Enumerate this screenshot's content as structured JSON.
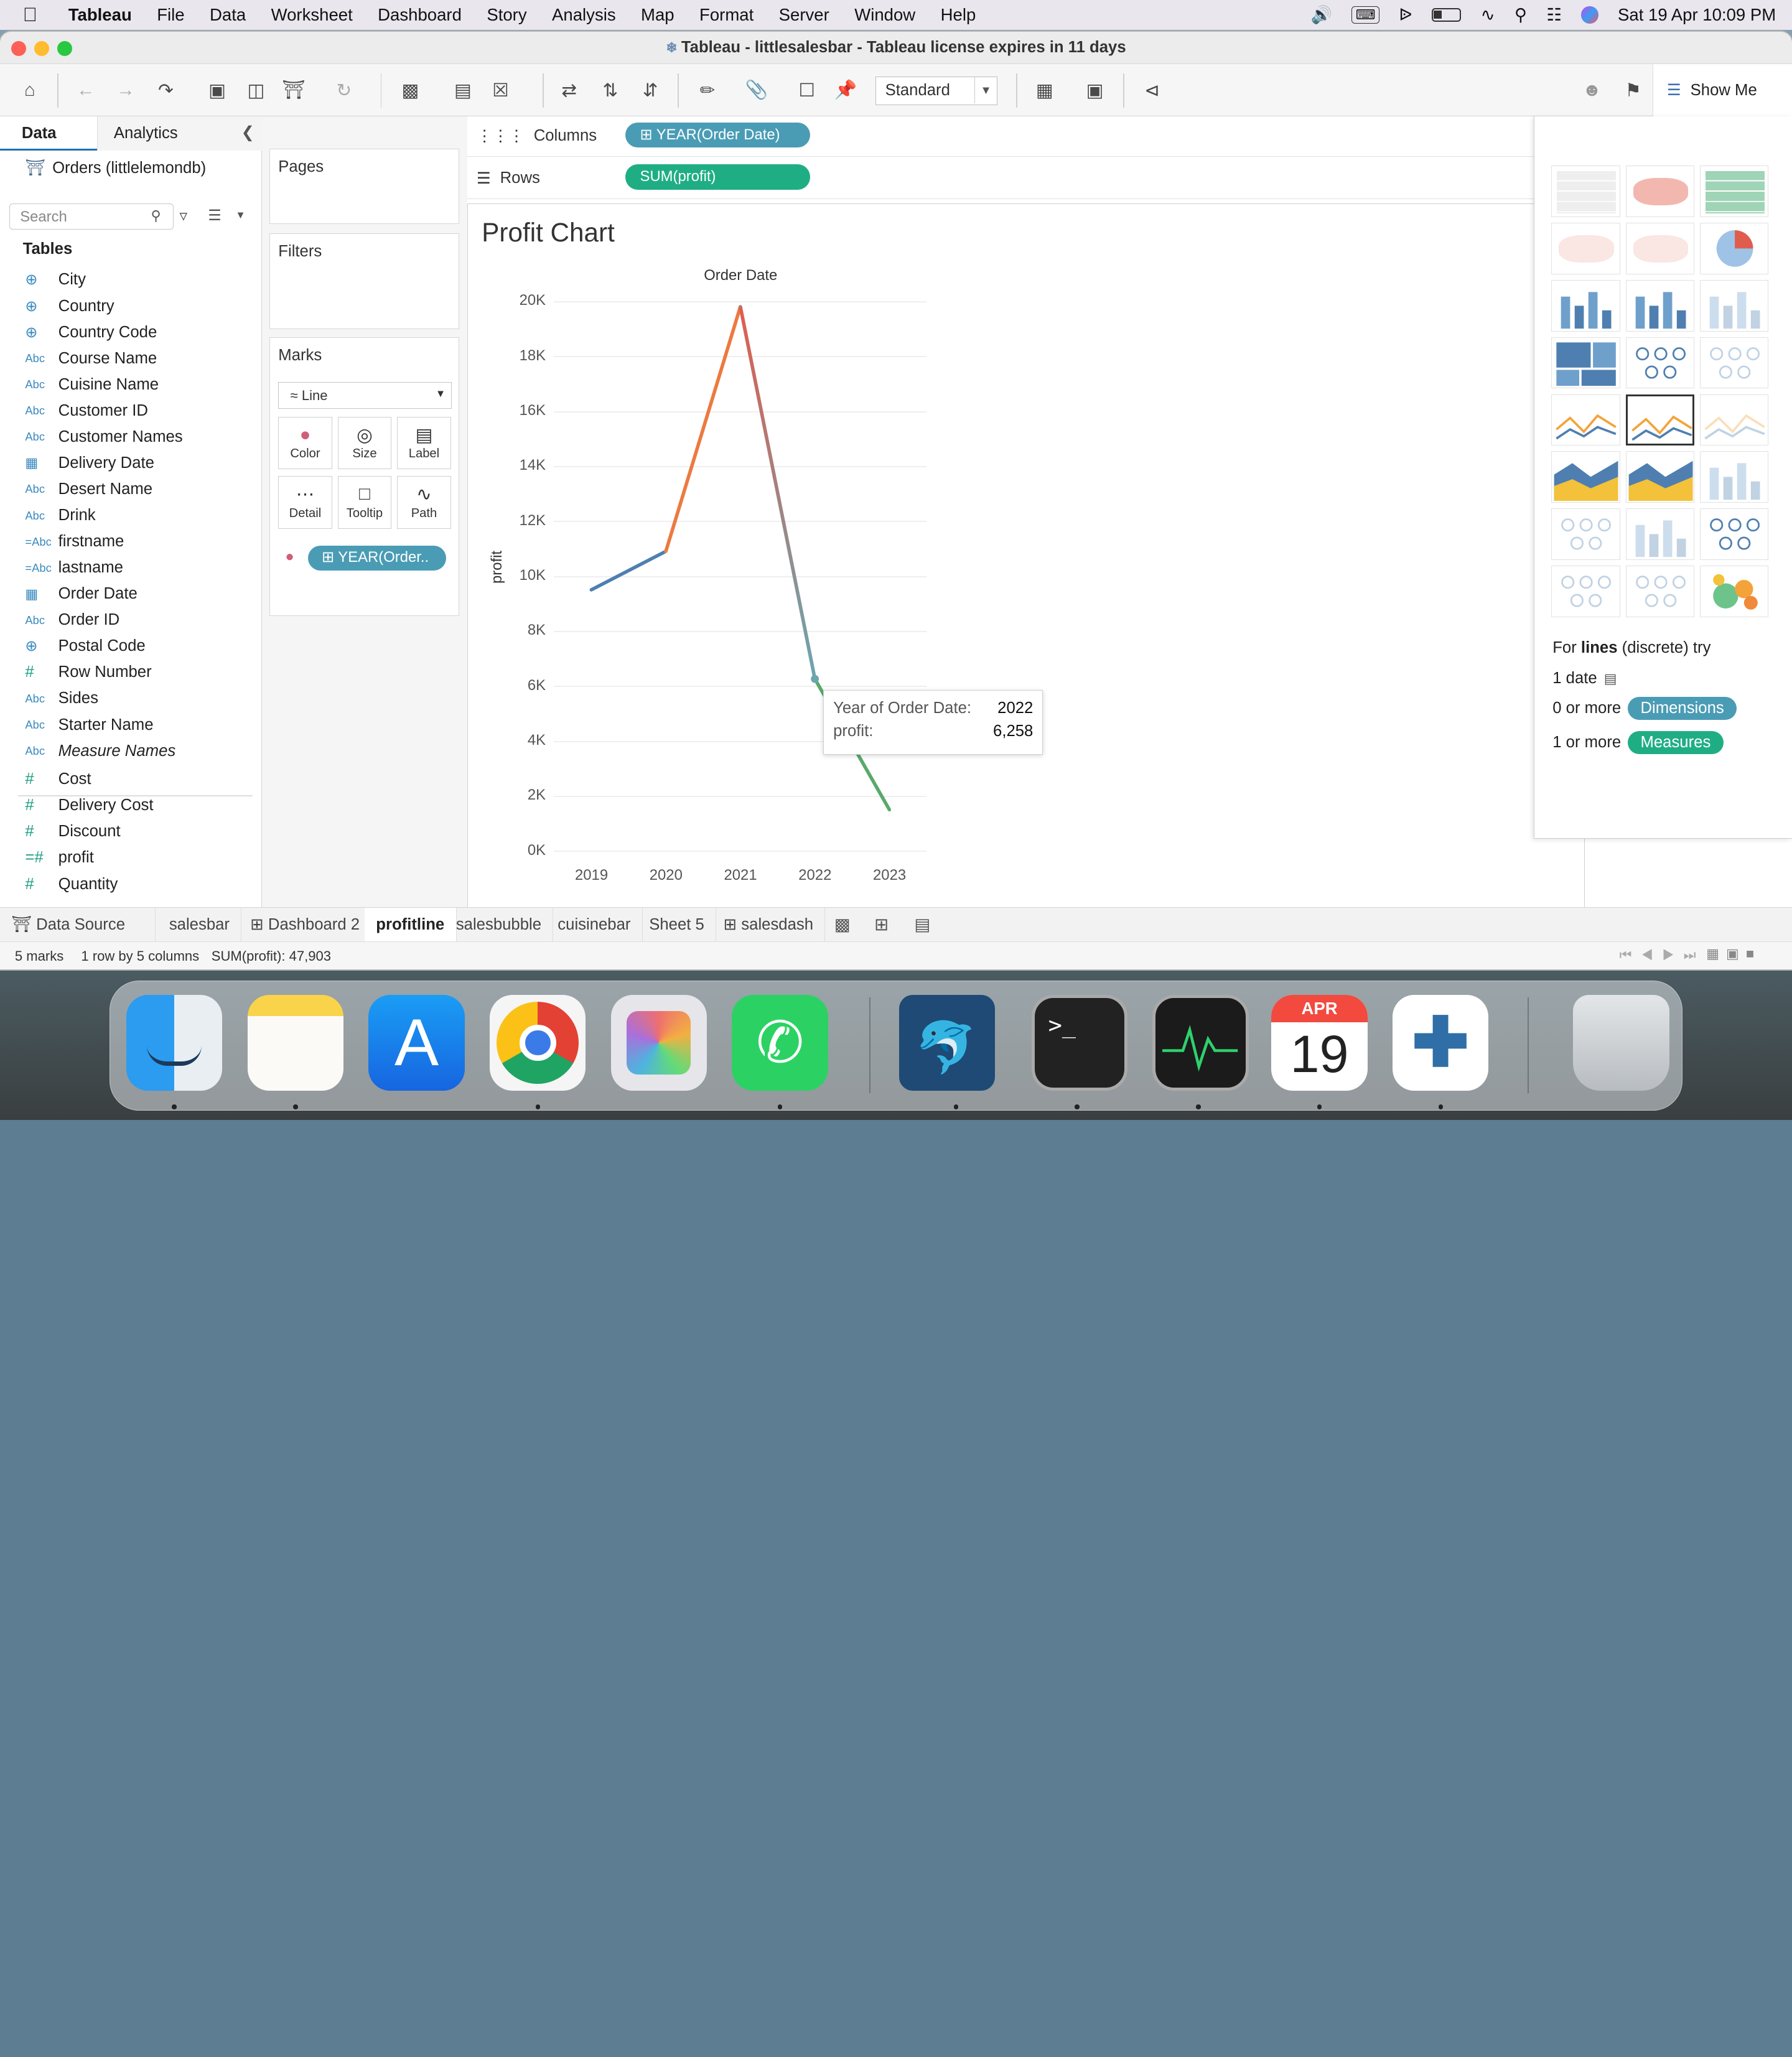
{
  "menubar": {
    "app": "Tableau",
    "items": [
      "File",
      "Data",
      "Worksheet",
      "Dashboard",
      "Story",
      "Analysis",
      "Map",
      "Format",
      "Server",
      "Window",
      "Help"
    ],
    "datetime": "Sat 19 Apr  10:09 PM"
  },
  "window": {
    "title": "Tableau - littlesalesbar - Tableau license expires in 11 days"
  },
  "toolbar": {
    "fit_select": "Standard",
    "show_me_label": "Show Me"
  },
  "left_panel": {
    "tabs": [
      "Data",
      "Analytics"
    ],
    "data_source": "Orders (littlelemondb)",
    "search_placeholder": "Search",
    "tables_header": "Tables",
    "fields": [
      {
        "icon": "globe",
        "name": "City"
      },
      {
        "icon": "globe",
        "name": "Country"
      },
      {
        "icon": "globe",
        "name": "Country Code"
      },
      {
        "icon": "Abc",
        "name": "Course Name"
      },
      {
        "icon": "Abc",
        "name": "Cuisine Name"
      },
      {
        "icon": "Abc",
        "name": "Customer ID"
      },
      {
        "icon": "Abc",
        "name": "Customer Names"
      },
      {
        "icon": "calendar",
        "name": "Delivery Date"
      },
      {
        "icon": "Abc",
        "name": "Desert Name"
      },
      {
        "icon": "Abc",
        "name": "Drink"
      },
      {
        "icon": "=Abc",
        "name": "firstname"
      },
      {
        "icon": "=Abc",
        "name": "lastname"
      },
      {
        "icon": "calendar",
        "name": "Order Date"
      },
      {
        "icon": "Abc",
        "name": "Order ID"
      },
      {
        "icon": "globe",
        "name": "Postal Code"
      },
      {
        "icon": "#",
        "name": "Row Number"
      },
      {
        "icon": "Abc",
        "name": "Sides"
      },
      {
        "icon": "Abc",
        "name": "Starter Name"
      },
      {
        "icon": "Abc",
        "name": "Measure Names"
      },
      {
        "icon": "#",
        "name": "Cost"
      },
      {
        "icon": "#",
        "name": "Delivery Cost"
      },
      {
        "icon": "#",
        "name": "Discount"
      },
      {
        "icon": "=#",
        "name": "profit"
      },
      {
        "icon": "#",
        "name": "Quantity"
      }
    ]
  },
  "cards": {
    "pages": "Pages",
    "filters": "Filters",
    "marks": "Marks",
    "mark_type": "Line",
    "mark_buttons": [
      "Color",
      "Size",
      "Label",
      "Detail",
      "Tooltip",
      "Path"
    ],
    "color_pill": "YEAR(Order.."
  },
  "shelves": {
    "columns_label": "Columns",
    "rows_label": "Rows",
    "columns_pill": "YEAR(Order Date)",
    "rows_pill": "SUM(profit)"
  },
  "view": {
    "title": "Profit Chart",
    "tooltip": {
      "k1": "Year of Order Date:",
      "v1": "2022",
      "k2": "profit:",
      "v2": "6,258"
    }
  },
  "chart_data": {
    "type": "line",
    "title": "Order Date",
    "xlabel": "",
    "ylabel": "profit",
    "categories": [
      "2019",
      "2020",
      "2021",
      "2022",
      "2023"
    ],
    "values": [
      9500,
      10900,
      19800,
      6258,
      1500
    ],
    "yticks": [
      "0K",
      "2K",
      "4K",
      "6K",
      "8K",
      "10K",
      "12K",
      "14K",
      "16K",
      "18K",
      "20K"
    ],
    "ylim": [
      0,
      20000
    ],
    "grid": true,
    "legend": "none"
  },
  "show_me": {
    "hint_prefix": "For ",
    "hint_bold": "lines",
    "hint_suffix": " (discrete) try",
    "line1": "1 date",
    "line2": "0 or more",
    "line3": "1 or more",
    "dimensions": "Dimensions",
    "measures": "Measures"
  },
  "sheet_tabs": {
    "data_source": "Data Source",
    "tabs": [
      "salesbar",
      "Dashboard 2",
      "profitline",
      "salesbubble",
      "cuisinebar",
      "Sheet 5",
      "salesdash"
    ],
    "active": "profitline"
  },
  "status": {
    "marks": "5 marks",
    "dims": "1 row by 5 columns",
    "sum": "SUM(profit): 47,903"
  },
  "dock": {
    "calendar_month": "APR",
    "calendar_day": "19"
  },
  "colors": {
    "dimension_pill": "#4a9cb5",
    "measure_pill": "#1fae84",
    "line_start": "#4f7fb0",
    "line_peak": "#e05d4e",
    "line_end": "#5aa96b"
  }
}
